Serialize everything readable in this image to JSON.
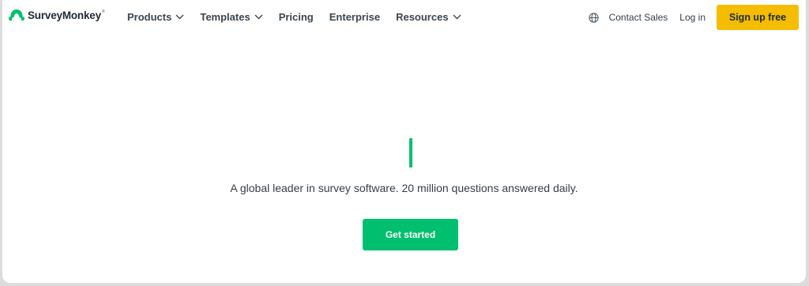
{
  "brand": {
    "name": "SurveyMonkey",
    "trademark": "®",
    "accent_color": "#00bf6f"
  },
  "nav": {
    "items": [
      {
        "label": "Products",
        "has_dropdown": true
      },
      {
        "label": "Templates",
        "has_dropdown": true
      },
      {
        "label": "Pricing",
        "has_dropdown": false
      },
      {
        "label": "Enterprise",
        "has_dropdown": false
      },
      {
        "label": "Resources",
        "has_dropdown": true
      }
    ]
  },
  "header_right": {
    "globe_icon": "globe-icon",
    "contact": "Contact Sales",
    "login": "Log in",
    "signup": "Sign up free",
    "signup_color": "#f5bd00"
  },
  "hero": {
    "tagline": "A global leader in survey software. 20 million questions answered daily.",
    "cta": "Get started",
    "cta_color": "#00bf6f"
  }
}
